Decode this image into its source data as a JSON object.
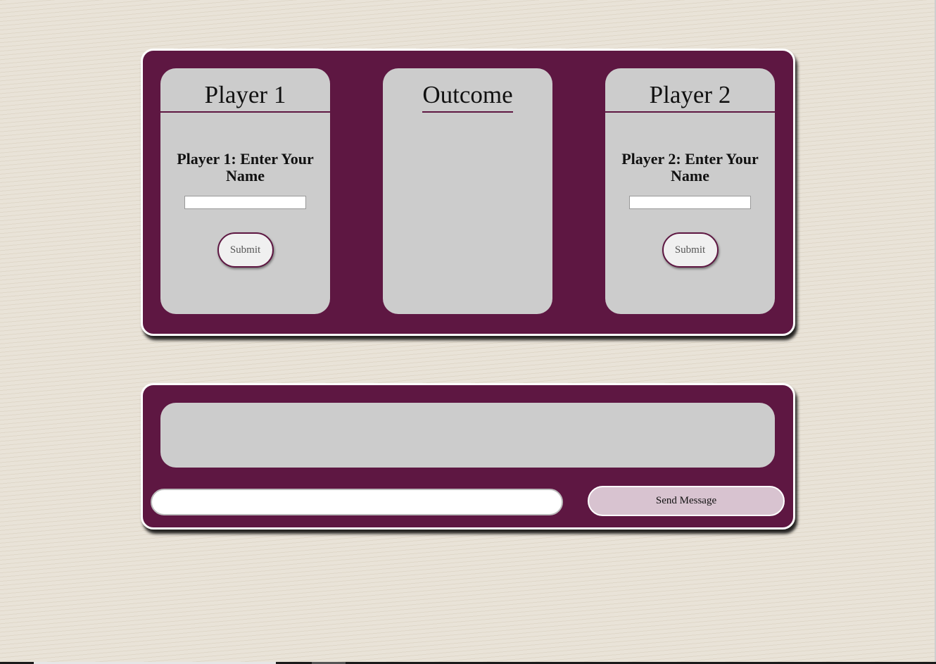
{
  "game": {
    "player1": {
      "title": "Player 1",
      "prompt": "Player 1: Enter Your Name",
      "name_value": "",
      "submit_label": "Submit"
    },
    "outcome": {
      "title": "Outcome"
    },
    "player2": {
      "title": "Player 2",
      "prompt": "Player 2: Enter Your Name",
      "name_value": "",
      "submit_label": "Submit"
    }
  },
  "chat": {
    "input_value": "",
    "send_label": "Send Message"
  },
  "colors": {
    "panel_bg": "#5e1742",
    "card_bg": "#cccccc",
    "page_bg": "#e9e3d8",
    "send_button_bg": "#d8c3d0"
  }
}
